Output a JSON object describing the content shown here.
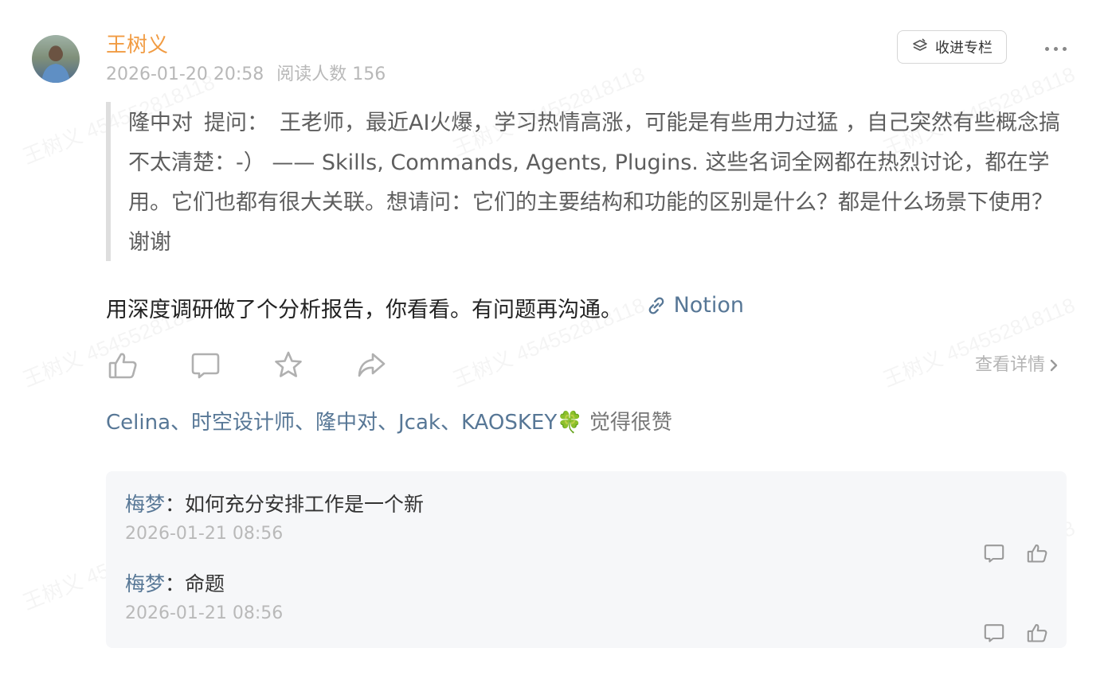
{
  "post": {
    "author": "王树义",
    "date": "2026-01-20 20:58",
    "reads": "阅读人数 156",
    "collect_label": "收进专栏",
    "quote": {
      "asker": "隆中对",
      "asker_label": "提问：",
      "text": "王老师，最近AI火爆，学习热情高涨，可能是有些用力过猛 ，自己突然有些概念搞不太清楚：-） —— Skills, Commands, Agents, Plugins. 这些名词全网都在热烈讨论，都在学用。它们也都有很大关联。想请问：它们的主要结构和功能的区别是什么？都是什么场景下使用？谢谢"
    },
    "body": "用深度调研做了个分析报告，你看看。有问题再沟通。",
    "link_label": "Notion",
    "detail_label": "查看详情",
    "likes_names": "Celina、时空设计师、隆中对、Jcak、KAOSKEY🍀",
    "likes_suffix": " 觉得很赞"
  },
  "comments": [
    {
      "name": "梅梦",
      "text": "如何充分安排工作是一个新",
      "time": "2026-01-21 08:56"
    },
    {
      "name": "梅梦",
      "text": "命题",
      "time": "2026-01-21 08:56"
    }
  ],
  "watermark": "王树义 454552818118",
  "colors": {
    "author": "#f19b42",
    "link": "#577796",
    "muted": "#b8b8b8",
    "comment_bg": "#f6f7f9"
  },
  "icons": [
    "collect-icon",
    "link-icon",
    "like-icon",
    "comment-icon",
    "star-icon",
    "share-icon",
    "chevron-right-icon"
  ]
}
